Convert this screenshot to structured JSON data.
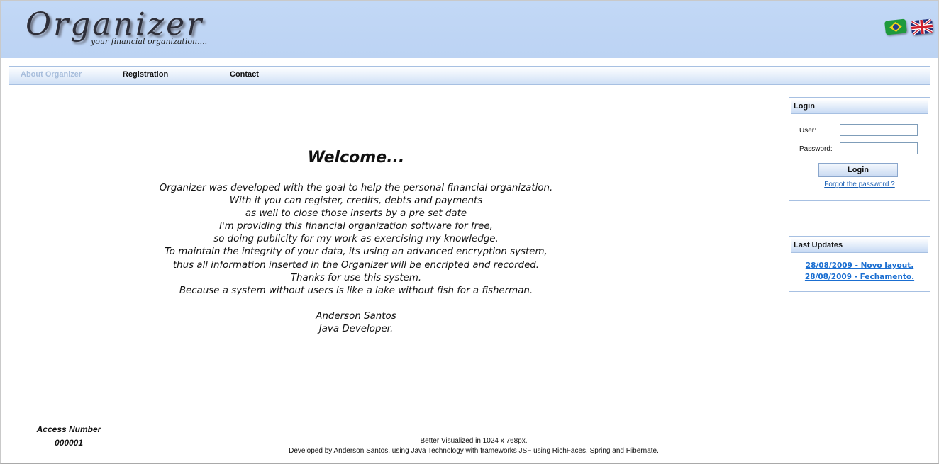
{
  "header": {
    "logo_title": "Organizer",
    "logo_subtitle": "your financial organization...."
  },
  "flags": [
    {
      "name": "brazil-flag-icon",
      "colors": [
        "#1f9a3c",
        "#f4d21c",
        "#1f3f8f"
      ]
    },
    {
      "name": "uk-flag-icon",
      "colors": [
        "#21307a",
        "#ffffff",
        "#d0202e"
      ]
    }
  ],
  "nav": {
    "items": [
      {
        "label": "About Organizer",
        "active": true
      },
      {
        "label": "Registration",
        "active": false
      },
      {
        "label": "Contact",
        "active": false
      }
    ]
  },
  "main": {
    "heading": "Welcome...",
    "paragraph": [
      "Organizer was developed with the goal to help the personal financial organization.",
      "With it you can register, credits, debts and payments",
      "as well to close those inserts by a pre set date",
      "I'm providing this financial organization software for free,",
      "so doing publicity for my work as exercising my knowledge.",
      "To maintain the integrity of your data, its using an advanced encryption system,",
      "thus all information inserted in the Organizer will be encripted and recorded.",
      "Thanks for use this system.",
      "Because a system without users is like a lake without fish for a fisherman."
    ],
    "signature": [
      "Anderson Santos",
      "Java Developer."
    ]
  },
  "login": {
    "title": "Login",
    "user_label": "User:",
    "user_value": "",
    "password_label": "Password:",
    "password_value": "",
    "button": "Login",
    "forgot": "Forgot the password ?"
  },
  "last_updates": {
    "title": "Last Updates",
    "items": [
      "28/08/2009 - Novo layout.",
      "28/08/2009 - Fechamento."
    ]
  },
  "access": {
    "label": "Access Number",
    "value": "000001"
  },
  "footer": {
    "line1": "Better Visualized in 1024 x 768px.",
    "line2": "Developed by Anderson Santos, using Java Technology with frameworks JSF using RichFaces, Spring and Hibernate."
  },
  "colors": {
    "header_bg": "#bcd3f3",
    "panel_border": "#a7c0e2",
    "link": "#1a6ed1",
    "nav_active": "#a8bedc"
  }
}
